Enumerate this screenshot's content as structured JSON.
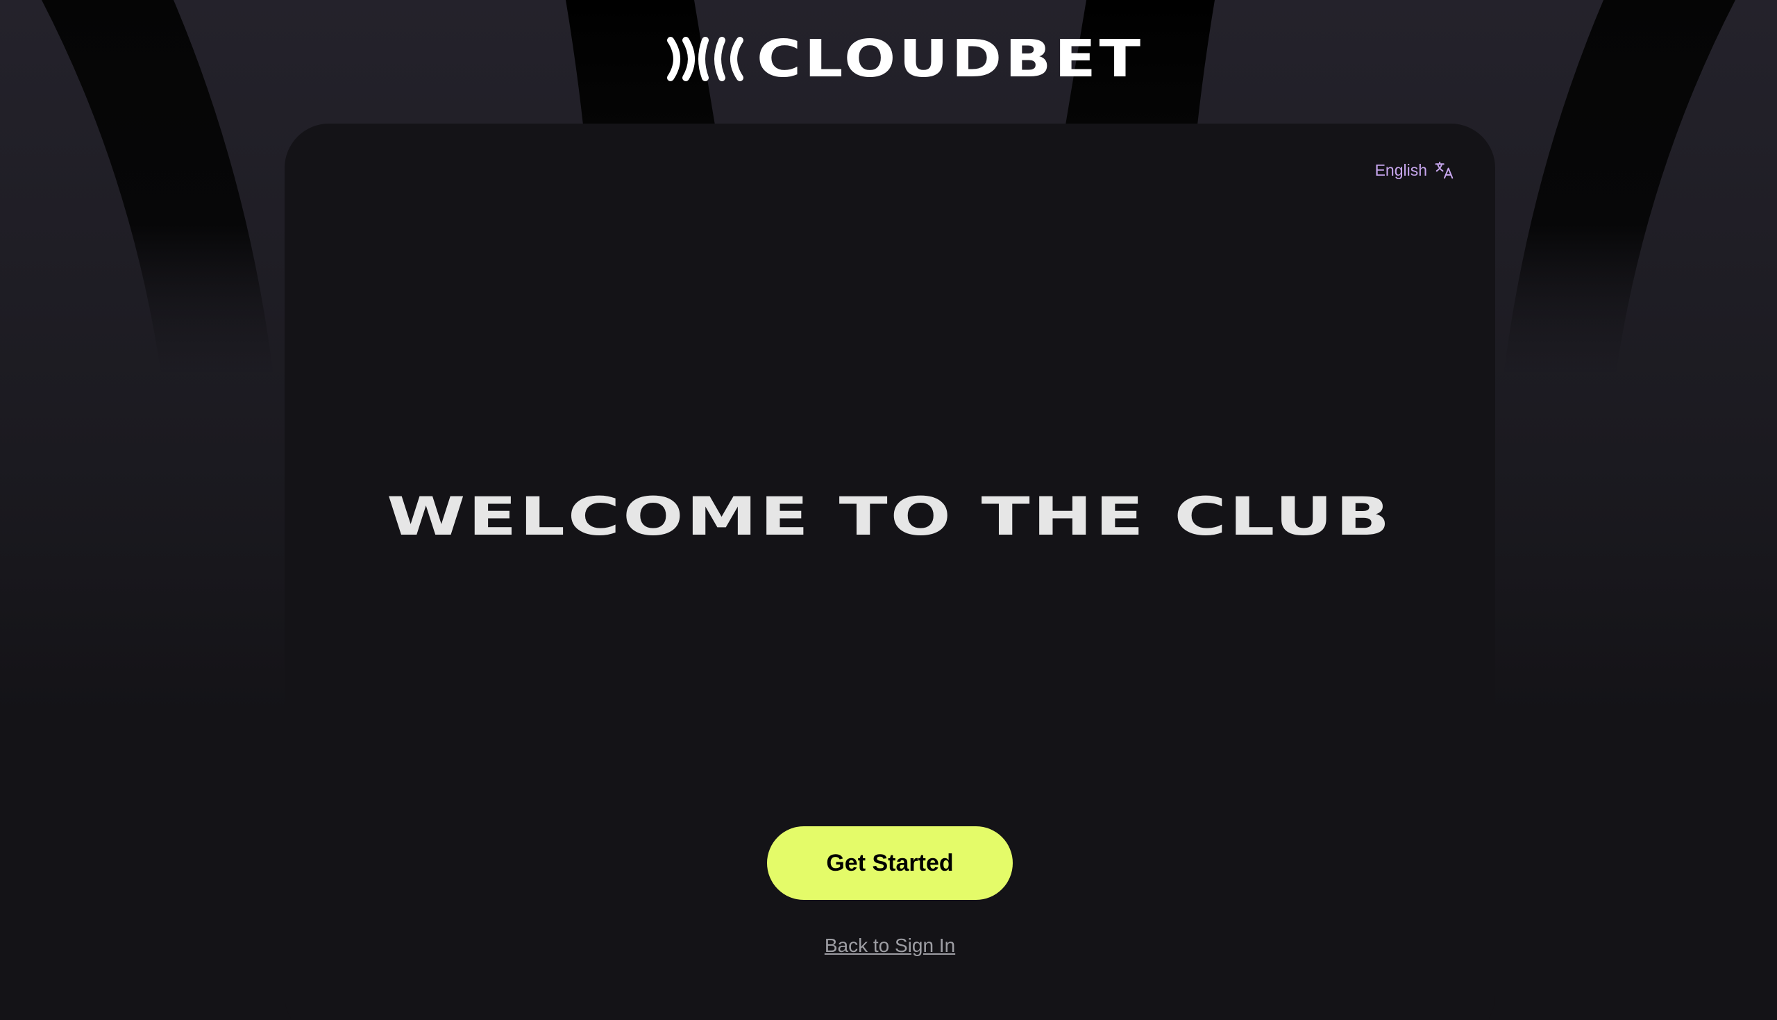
{
  "brand": {
    "name": "CLOUDBET",
    "logo_icon": "cloudbet-brackets-logo-icon"
  },
  "language": {
    "label": "English",
    "icon": "translate-icon"
  },
  "main": {
    "headline": "WELCOME TO THE CLUB",
    "primary_button": "Get Started",
    "secondary_link": "Back to Sign In"
  },
  "colors": {
    "accent": "#e4fb69",
    "language_text": "#c7a6ee",
    "background": "#141317"
  }
}
